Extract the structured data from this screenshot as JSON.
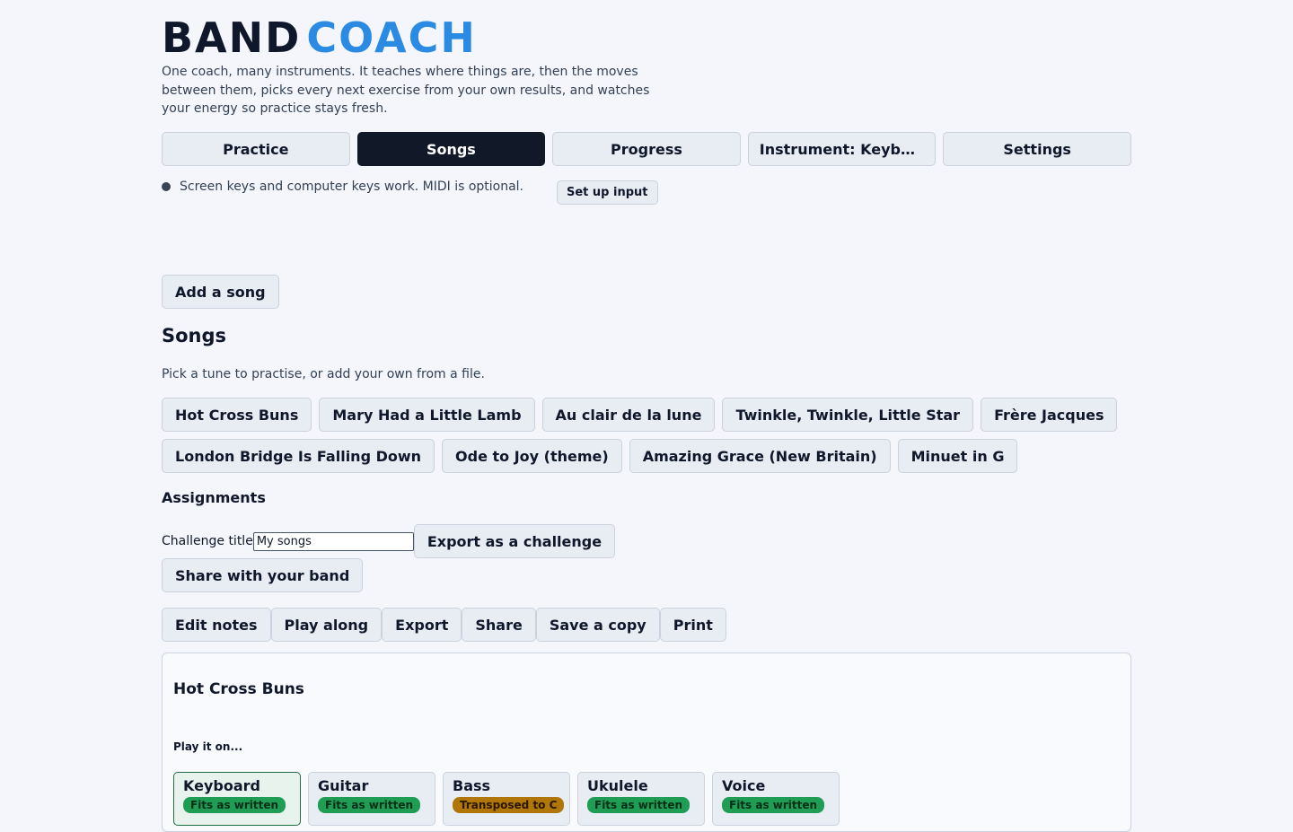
{
  "brand": {
    "part1": "BAND",
    "part2": "COACH"
  },
  "tagline": "One coach, many instruments. It teaches where things are, then the moves between them, picks every next exercise from your own results, and watches your energy so practice stays fresh.",
  "nav": [
    {
      "label": "Practice",
      "active": false
    },
    {
      "label": "Songs",
      "active": true
    },
    {
      "label": "Progress",
      "active": false
    },
    {
      "label": "Instrument: Keyboard",
      "active": false
    },
    {
      "label": "Settings",
      "active": false
    }
  ],
  "status": {
    "text": "Screen keys and computer keys work. MIDI is optional.",
    "button": "Set up input"
  },
  "add_song": "Add a song",
  "songs": {
    "title": "Songs",
    "subtitle": "Pick a tune to practise, or add your own from a file.",
    "items": [
      "Hot Cross Buns",
      "Mary Had a Little Lamb",
      "Au clair de la lune",
      "Twinkle, Twinkle, Little Star",
      "Frère Jacques",
      "London Bridge Is Falling Down",
      "Ode to Joy (theme)",
      "Amazing Grace (New Britain)",
      "Minuet in G"
    ]
  },
  "assignments": {
    "title": "Assignments",
    "challenge_label": "Challenge title",
    "challenge_value": "My songs",
    "export_challenge": "Export as a challenge",
    "share_band": "Share with your band"
  },
  "actions": [
    "Edit notes",
    "Play along",
    "Export",
    "Share",
    "Save a copy",
    "Print"
  ],
  "selected_song": {
    "title": "Hot Cross Buns",
    "play_on_label": "Play it on...",
    "instruments": [
      {
        "name": "Keyboard",
        "fit": "Fits as written",
        "selected": true,
        "warn": false
      },
      {
        "name": "Guitar",
        "fit": "Fits as written",
        "selected": false,
        "warn": false
      },
      {
        "name": "Bass",
        "fit": "Transposed to C",
        "selected": false,
        "warn": true
      },
      {
        "name": "Ukulele",
        "fit": "Fits as written",
        "selected": false,
        "warn": false
      },
      {
        "name": "Voice",
        "fit": "Fits as written",
        "selected": false,
        "warn": false
      }
    ]
  }
}
